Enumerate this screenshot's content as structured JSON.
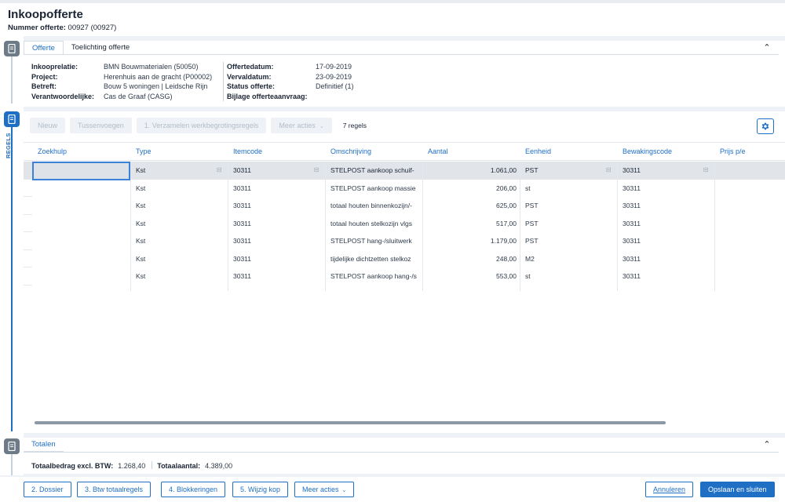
{
  "header": {
    "title": "Inkoopofferte",
    "number_label": "Nummer offerte:",
    "number_value": "00927 (00927)"
  },
  "rail": {
    "regels_label": "REGELS"
  },
  "offerte_panel": {
    "tabs": [
      "Offerte",
      "Toelichting offerte"
    ],
    "left_fields": [
      {
        "label": "Inkooprelatie:",
        "value": "BMN Bouwmaterialen (50050)"
      },
      {
        "label": "Project:",
        "value": "Herenhuis aan de gracht (P00002)"
      },
      {
        "label": "Betreft:",
        "value": "Bouw 5 woningen | Leidsche Rijn"
      },
      {
        "label": "Verantwoordelijke:",
        "value": "Cas de Graaf (CASG)"
      }
    ],
    "right_fields": [
      {
        "label": "Offertedatum:",
        "value": "17-09-2019"
      },
      {
        "label": "Vervaldatum:",
        "value": "23-09-2019"
      },
      {
        "label": "Status offerte:",
        "value": "Definitief (1)"
      },
      {
        "label": "Bijlage offerteaanvraag:",
        "value": ""
      }
    ]
  },
  "toolbar": {
    "nieuw": "Nieuw",
    "tussenvoegen": "Tussenvoegen",
    "verzamelen": "1. Verzamelen werkbegrotingsregels",
    "meer_acties": "Meer acties",
    "row_count": "7 regels"
  },
  "grid": {
    "columns": [
      "Zoekhulp",
      "Type",
      "Itemcode",
      "Omschrijving",
      "Aantal",
      "Eenheid",
      "Bewakingscode",
      "Prijs p/e"
    ],
    "rows": [
      {
        "zoekhulp": "",
        "type": "Kst",
        "itemcode": "30311",
        "omschrijving": "STELPOST aankoop schuif-",
        "aantal": "1.061,00",
        "eenheid": "PST",
        "bewakingscode": "30311",
        "prijs": ""
      },
      {
        "zoekhulp": "",
        "type": "Kst",
        "itemcode": "30311",
        "omschrijving": "STELPOST aankoop massie",
        "aantal": "206,00",
        "eenheid": "st",
        "bewakingscode": "30311",
        "prijs": ""
      },
      {
        "zoekhulp": "",
        "type": "Kst",
        "itemcode": "30311",
        "omschrijving": "totaal houten binnenkozijn/-",
        "aantal": "625,00",
        "eenheid": "PST",
        "bewakingscode": "30311",
        "prijs": ""
      },
      {
        "zoekhulp": "",
        "type": "Kst",
        "itemcode": "30311",
        "omschrijving": "totaal houten stelkozijn vlgs",
        "aantal": "517,00",
        "eenheid": "PST",
        "bewakingscode": "30311",
        "prijs": ""
      },
      {
        "zoekhulp": "",
        "type": "Kst",
        "itemcode": "30311",
        "omschrijving": "STELPOST hang-/sluitwerk",
        "aantal": "1.179,00",
        "eenheid": "PST",
        "bewakingscode": "30311",
        "prijs": ""
      },
      {
        "zoekhulp": "",
        "type": "Kst",
        "itemcode": "30311",
        "omschrijving": "tijdelijke dichtzetten stelkoz",
        "aantal": "248,00",
        "eenheid": "M2",
        "bewakingscode": "30311",
        "prijs": ""
      },
      {
        "zoekhulp": "",
        "type": "Kst",
        "itemcode": "30311",
        "omschrijving": "STELPOST aankoop hang-/s",
        "aantal": "553,00",
        "eenheid": "st",
        "bewakingscode": "30311",
        "prijs": ""
      }
    ]
  },
  "totals_panel": {
    "tab": "Totalen",
    "bedrag_label": "Totaalbedrag excl. BTW:",
    "bedrag_value": "1.268,40",
    "aantal_label": "Totaalaantal:",
    "aantal_value": "4.389,00"
  },
  "footer": {
    "dossier": "2. Dossier",
    "btw": "3. Btw totaalregels",
    "blokkeringen": "4. Blokkeringen",
    "wijzig_kop": "5. Wijzig kop",
    "meer_acties": "Meer acties",
    "annuleren": "Annuleren",
    "opslaan": "Opslaan en sluiten"
  },
  "colors": {
    "accent": "#1f6fc5",
    "rail_icon": "#6d7a88",
    "background": "#eef1f5"
  },
  "icons": [
    "document-icon",
    "collapse-chevron-icon",
    "gear-icon",
    "lookup-icon",
    "caret-down-icon"
  ]
}
